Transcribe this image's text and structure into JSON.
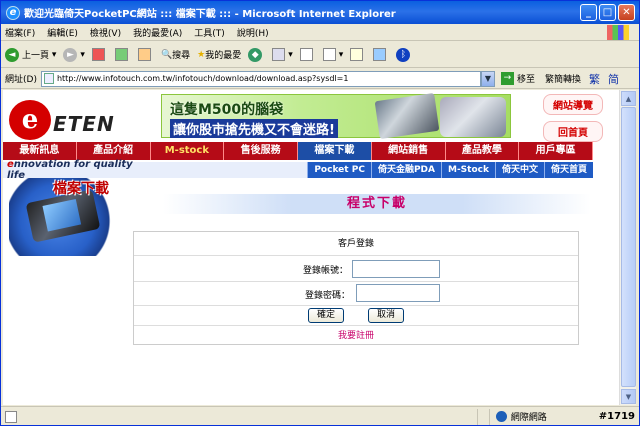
{
  "window": {
    "title": "歡迎光臨倚天PocketPC網站 ::: 檔案下載 ::: - Microsoft Internet Explorer"
  },
  "menu": [
    "檔案(F)",
    "編輯(E)",
    "檢視(V)",
    "我的最愛(A)",
    "工具(T)",
    "說明(H)"
  ],
  "toolbar": {
    "back": "上一頁",
    "search": "搜尋",
    "favorites": "我的最愛"
  },
  "address": {
    "label": "網址(D)",
    "url": "http://www.infotouch.com.tw/infotouch/download/download.asp?sysdl=1",
    "go": "移至",
    "convert": "繁簡轉換",
    "trad": "繁",
    "simp": "简"
  },
  "site": {
    "brand": "ETEN",
    "banner_line1": "這隻M500的腦袋",
    "banner_line2": "讓你股市搶先機又不會迷路!",
    "side_links": [
      "網站導覽",
      "回首頁"
    ],
    "nav": [
      "最新訊息",
      "產品介紹",
      "M-stock",
      "售後服務",
      "檔案下載",
      "網站銷售",
      "產品教學",
      "用戶專區"
    ],
    "nav_active": 4,
    "tagline": "nnovation for quality life",
    "sub_links": [
      "Pocket PC",
      "倚天金融PDA",
      "M-Stock",
      "倚天中文",
      "倚天首頁"
    ],
    "section_label": "檔案下載",
    "page_title": "程式下載"
  },
  "form": {
    "heading": "客戶登錄",
    "account_label": "登錄帳號：",
    "password_label": "登錄密碼：",
    "ok": "確定",
    "cancel": "取消",
    "register": "我要註冊"
  },
  "status": {
    "zone": "網際網路",
    "badge": "#1719"
  }
}
